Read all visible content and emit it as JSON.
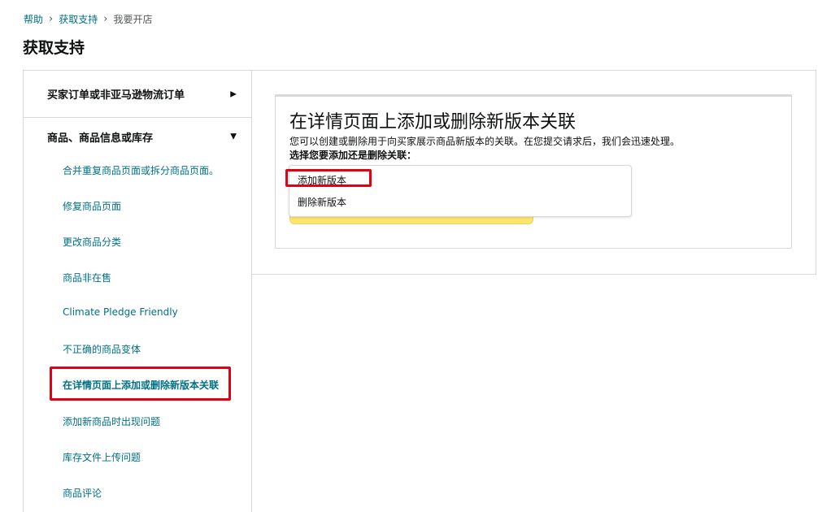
{
  "breadcrumb": {
    "items": [
      "帮助",
      "获取支持",
      "我要开店"
    ],
    "separator": "›"
  },
  "page_title": "获取支持",
  "sidebar": {
    "categories": [
      {
        "label": "买家订单或非亚马逊物流订单",
        "arrow": "▶"
      },
      {
        "label": "商品、商品信息或库存",
        "arrow": "▼"
      }
    ],
    "items": [
      "合并重复商品页面或拆分商品页面。",
      "修复商品页面",
      "更改商品分类",
      "商品非在售",
      "Climate Pledge Friendly",
      "不正确的商品变体",
      "在详情页面上添加或删除新版本关联",
      "添加新商品时出现问题",
      "库存文件上传问题",
      "商品评论"
    ]
  },
  "card": {
    "title": "在详情页面上添加或删除新版本关联",
    "description": "您可以创建或删除用于向买家展示商品新版本的关联。在您提交请求后，我们会迅速处理。",
    "label": "选择您要添加还是删除关联："
  },
  "dropdown": {
    "options": [
      "添加新版本",
      "删除新版本"
    ]
  },
  "colors": {
    "link": "#007185",
    "highlight": "#e3000f",
    "button_yellow": "#fde66a",
    "border": "#d5d9d9"
  }
}
